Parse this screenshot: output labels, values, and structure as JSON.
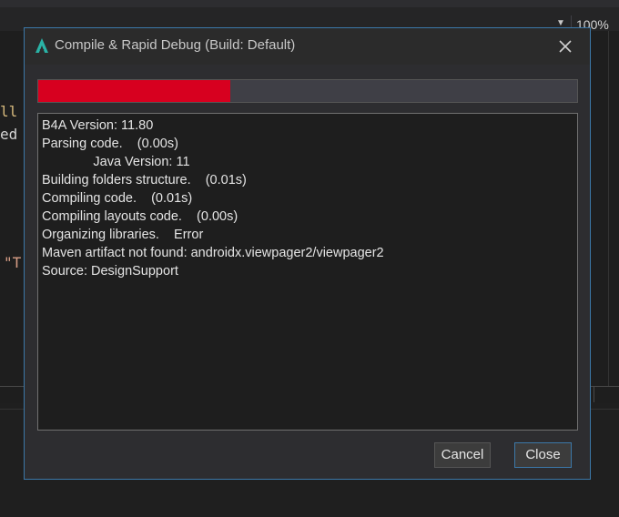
{
  "ide": {
    "zoom": "100%",
    "code_fragments": {
      "l1": "ll",
      "l2": "ed",
      "l3": "\"T"
    }
  },
  "dialog": {
    "title": "Compile & Rapid Debug (Build: Default)",
    "progress_fraction": 0.357,
    "log_lines": [
      "B4A Version: 11.80",
      "Parsing code.    (0.00s)",
      "              Java Version: 11",
      "Building folders structure.    (0.01s)",
      "Compiling code.    (0.01s)",
      "Compiling layouts code.    (0.00s)",
      "Organizing libraries.    Error",
      "Maven artifact not found: androidx.viewpager2/viewpager2",
      "Source: DesignSupport"
    ],
    "buttons": {
      "cancel": "Cancel",
      "close": "Close"
    }
  },
  "colors": {
    "accent": "#3c78a8",
    "progress": "#d7001f",
    "logo": "#2ab3a6",
    "code_orange": "#d7ba7d"
  },
  "icons": {
    "logo": "b4a-logo-icon",
    "close": "close-icon",
    "dropdown": "chevron-down-icon"
  }
}
